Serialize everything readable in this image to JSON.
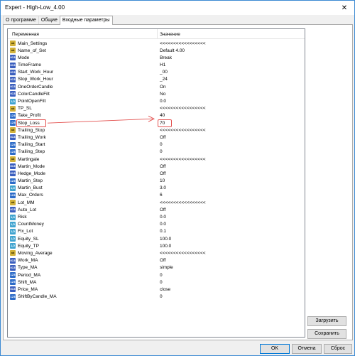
{
  "window": {
    "title": "Expert - High-Low_4.00",
    "close_glyph": "✕"
  },
  "tabs": [
    {
      "label": "О программе",
      "active": false
    },
    {
      "label": "Общие",
      "active": false
    },
    {
      "label": "Входные параметры",
      "active": true
    }
  ],
  "grid": {
    "header_name": "Переменная",
    "header_value": "Значение",
    "rows": [
      {
        "icon": "ab",
        "icon_text": "ab",
        "name": "Main_Settings",
        "value": "<<<<<<<<<<<<<<<<<"
      },
      {
        "icon": "ab",
        "icon_text": "ab",
        "name": "Name_of_Set",
        "value": "Default 4.00"
      },
      {
        "icon": "enm",
        "icon_text": "013",
        "name": "Mode",
        "value": "Break"
      },
      {
        "icon": "enm",
        "icon_text": "013",
        "name": "TimeFrame",
        "value": "H1"
      },
      {
        "icon": "enm",
        "icon_text": "013",
        "name": "Start_Work_Hour",
        "value": "_00"
      },
      {
        "icon": "enm",
        "icon_text": "013",
        "name": "Stop_Work_Hour",
        "value": "_24"
      },
      {
        "icon": "enm",
        "icon_text": "013",
        "name": "OneOrderCandle",
        "value": "On"
      },
      {
        "icon": "enm",
        "icon_text": "013",
        "name": "ColorCandleFilt",
        "value": "No"
      },
      {
        "icon": "dbl",
        "icon_text": "1/2",
        "name": "PointOpenFilt",
        "value": "0.0"
      },
      {
        "icon": "ab",
        "icon_text": "ab",
        "name": "TP_SL",
        "value": "<<<<<<<<<<<<<<<<<"
      },
      {
        "icon": "num",
        "icon_text": "123",
        "name": "Take_Profit",
        "value": "40"
      },
      {
        "icon": "num",
        "icon_text": "123",
        "name": "Stop_Loss",
        "value": "70"
      },
      {
        "icon": "ab",
        "icon_text": "ab",
        "name": "Trailing_Stop",
        "value": "<<<<<<<<<<<<<<<<<"
      },
      {
        "icon": "enm",
        "icon_text": "013",
        "name": "Trailing_Work",
        "value": "Off"
      },
      {
        "icon": "num",
        "icon_text": "123",
        "name": "Trailing_Start",
        "value": "0"
      },
      {
        "icon": "num",
        "icon_text": "123",
        "name": "Trailing_Step",
        "value": "0"
      },
      {
        "icon": "ab",
        "icon_text": "ab",
        "name": "Martingale",
        "value": "<<<<<<<<<<<<<<<<<"
      },
      {
        "icon": "enm",
        "icon_text": "013",
        "name": "Martin_Mode",
        "value": "Off"
      },
      {
        "icon": "enm",
        "icon_text": "013",
        "name": "Hedge_Mode",
        "value": "Off"
      },
      {
        "icon": "num",
        "icon_text": "123",
        "name": "Martin_Step",
        "value": "10"
      },
      {
        "icon": "dbl",
        "icon_text": "1/2",
        "name": "Martin_Bust",
        "value": "3.0"
      },
      {
        "icon": "num",
        "icon_text": "123",
        "name": "Max_Orders",
        "value": "6"
      },
      {
        "icon": "ab",
        "icon_text": "ab",
        "name": "Lot_MM",
        "value": "<<<<<<<<<<<<<<<<<"
      },
      {
        "icon": "enm",
        "icon_text": "013",
        "name": "Auto_Lot",
        "value": "Off"
      },
      {
        "icon": "dbl",
        "icon_text": "1/2",
        "name": "Risk",
        "value": "0.0"
      },
      {
        "icon": "dbl",
        "icon_text": "1/2",
        "name": "CountMoney",
        "value": "0.0"
      },
      {
        "icon": "dbl",
        "icon_text": "1/2",
        "name": "Fix_Lot",
        "value": "0.1"
      },
      {
        "icon": "dbl",
        "icon_text": "1/2",
        "name": "Equity_SL",
        "value": "100.0"
      },
      {
        "icon": "dbl",
        "icon_text": "1/2",
        "name": "Equity_TP",
        "value": "100.0"
      },
      {
        "icon": "ab",
        "icon_text": "ab",
        "name": "Moving_Average",
        "value": "<<<<<<<<<<<<<<<<<"
      },
      {
        "icon": "enm",
        "icon_text": "013",
        "name": "Work_MA",
        "value": "Off"
      },
      {
        "icon": "enm",
        "icon_text": "013",
        "name": "Type_MA",
        "value": "simple"
      },
      {
        "icon": "num",
        "icon_text": "123",
        "name": "Period_MA",
        "value": "0"
      },
      {
        "icon": "num",
        "icon_text": "123",
        "name": "Shift_MA",
        "value": "0"
      },
      {
        "icon": "enm",
        "icon_text": "013",
        "name": "Price_MA",
        "value": "close"
      },
      {
        "icon": "num",
        "icon_text": "123",
        "name": "ShiftByCandle_MA",
        "value": "0"
      }
    ]
  },
  "annotation": {
    "color": "#e3514f",
    "target_row": "Stop_Loss"
  },
  "side_buttons": {
    "load": "Загрузить",
    "save": "Сохранить"
  },
  "footer_buttons": {
    "ok": "OK",
    "cancel": "Отмена",
    "reset": "Сброс"
  }
}
